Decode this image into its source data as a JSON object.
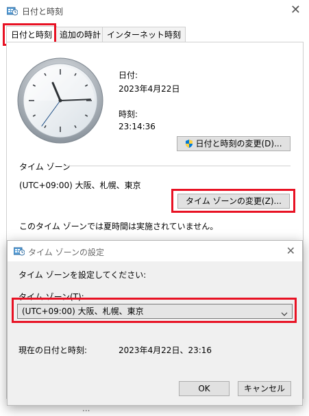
{
  "window": {
    "title": "日付と時刻",
    "close_glyph": "✕",
    "tabs": [
      {
        "label": "日付と時刻"
      },
      {
        "label": "追加の時計"
      },
      {
        "label": "インターネット時刻"
      }
    ]
  },
  "datetime_tab": {
    "date_label": "日付:",
    "date_value": "2023年4月22日",
    "time_label": "時刻:",
    "time_value": "23:14:36",
    "change_datetime_button": "日付と時刻の変更(D)...",
    "timezone_group_label": "タイム ゾーン",
    "timezone_value": "(UTC+09:00) 大阪、札幌、東京",
    "change_timezone_button": "タイム ゾーンの変更(Z)...",
    "dst_note": "このタイム ゾーンでは夏時間は実施されていません。",
    "bottom_link_fragment": "...",
    "clock": {
      "hours": 23,
      "minutes": 14,
      "seconds": 36
    }
  },
  "timezone_dialog": {
    "title": "タイム ゾーンの設定",
    "close_glyph": "✕",
    "prompt": "タイム ゾーンを設定してください:",
    "select_label": "タイム ゾーン(T):",
    "selected_option": "(UTC+09:00) 大阪、札幌、東京",
    "current_label": "現在の日付と時刻:",
    "current_value": "2023年4月22日、23:16",
    "ok_button": "OK",
    "cancel_button": "キャンセル"
  },
  "colors": {
    "highlight_red": "#e81123",
    "accent_blue": "#0078d7"
  }
}
